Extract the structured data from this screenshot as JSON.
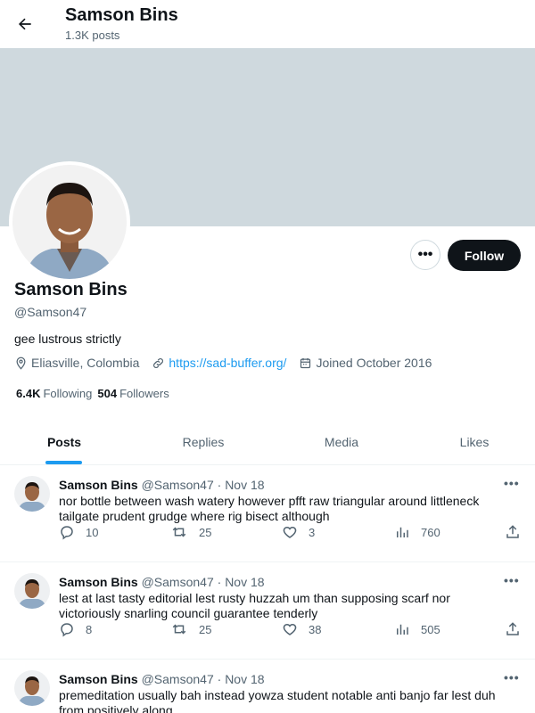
{
  "header": {
    "name": "Samson Bins",
    "posts_count": "1.3K posts"
  },
  "profile": {
    "name": "Samson Bins",
    "handle": "@Samson47",
    "bio": "gee lustrous strictly",
    "location": "Eliasville, Colombia",
    "website": "https://sad-buffer.org/",
    "joined": "Joined October 2016",
    "following_count": "6.4K",
    "following_label": "Following",
    "followers_count": "504",
    "followers_label": "Followers",
    "follow_button": "Follow",
    "more_button": "•••"
  },
  "tabs": [
    {
      "label": "Posts",
      "active": true
    },
    {
      "label": "Replies",
      "active": false
    },
    {
      "label": "Media",
      "active": false
    },
    {
      "label": "Likes",
      "active": false
    }
  ],
  "posts": [
    {
      "name": "Samson Bins",
      "handle": "@Samson47",
      "date": "· Nov 18",
      "text": "nor bottle between wash watery however pfft raw triangular around littleneck tailgate prudent grudge where rig bisect although",
      "replies": "10",
      "reposts": "25",
      "likes": "3",
      "views": "760"
    },
    {
      "name": "Samson Bins",
      "handle": "@Samson47",
      "date": "· Nov 18",
      "text": "lest at last tasty editorial lest rusty huzzah um than supposing scarf nor victoriously snarling council guarantee tenderly",
      "replies": "8",
      "reposts": "25",
      "likes": "38",
      "views": "505"
    },
    {
      "name": "Samson Bins",
      "handle": "@Samson47",
      "date": "· Nov 18",
      "text": "premeditation usually bah instead yowza student notable anti banjo far lest duh from positively along",
      "replies": "",
      "reposts": "",
      "likes": "",
      "views": ""
    }
  ],
  "colors": {
    "accent": "#1d9bf0",
    "banner": "#cfd9de",
    "text": "#0f1419",
    "muted": "#536471"
  }
}
